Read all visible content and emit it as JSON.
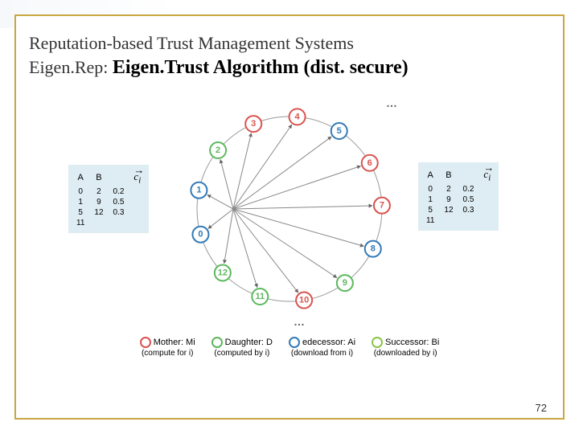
{
  "title_line1": "Reputation-based Trust Management Systems",
  "title_prefix": "Eigen.Rep: ",
  "title_main": "Eigen.Trust Algorithm (dist. secure)",
  "page_number": "72",
  "nodes": [
    {
      "id": 0,
      "color": "blue"
    },
    {
      "id": 1,
      "color": "blue"
    },
    {
      "id": 2,
      "color": "green"
    },
    {
      "id": 3,
      "color": "red"
    },
    {
      "id": 4,
      "color": "red"
    },
    {
      "id": 5,
      "color": "blue"
    },
    {
      "id": 6,
      "color": "red"
    },
    {
      "id": 7,
      "color": "red"
    },
    {
      "id": 8,
      "color": "blue"
    },
    {
      "id": 9,
      "color": "green"
    },
    {
      "id": 10,
      "color": "red"
    },
    {
      "id": 11,
      "color": "green"
    },
    {
      "id": 12,
      "color": "green"
    }
  ],
  "arrows": [
    {
      "from": "center",
      "to": 0
    },
    {
      "from": "center",
      "to": 1
    },
    {
      "from": "center",
      "to": 2
    },
    {
      "from": "center",
      "to": 3
    },
    {
      "from": "center",
      "to": 4
    },
    {
      "from": "center",
      "to": 5
    },
    {
      "from": "center",
      "to": 6
    },
    {
      "from": "center",
      "to": 7
    },
    {
      "from": "center",
      "to": 8
    },
    {
      "from": "center",
      "to": 9
    },
    {
      "from": "center",
      "to": 10
    },
    {
      "from": "center",
      "to": 11
    },
    {
      "from": "center",
      "to": 12
    }
  ],
  "left_table": {
    "headers": [
      "A",
      "B",
      ""
    ],
    "vector_label": "c⃗ᵢ",
    "rows": [
      [
        "0",
        "2",
        "0.2"
      ],
      [
        "1",
        "9",
        "0.5"
      ],
      [
        "5",
        "12",
        "0.3"
      ],
      [
        "11",
        "",
        ""
      ]
    ]
  },
  "right_table": {
    "headers": [
      "A",
      "B",
      ""
    ],
    "vector_label": "c⃗ᵢ",
    "rows": [
      [
        "0",
        "2",
        "0.2"
      ],
      [
        "1",
        "9",
        "0.5"
      ],
      [
        "5",
        "12",
        "0.3"
      ],
      [
        "11",
        "",
        ""
      ]
    ]
  },
  "legend": [
    {
      "color": "red",
      "label": "Mother: Mi",
      "sub": "(compute for i)"
    },
    {
      "color": "green",
      "label": "Daughter: D",
      "sub": "(computed by i)"
    },
    {
      "color": "blue",
      "label": "edecessor: Ai",
      "sub": "(download from i)"
    },
    {
      "color": "lime",
      "label": "Successor: Bi",
      "sub": "(downloaded by i)"
    }
  ],
  "colors": {
    "red": "#d9534f",
    "green": "#5cb85c",
    "blue": "#337ab7",
    "lime": "#8bc34a"
  },
  "ellipsis": "…"
}
